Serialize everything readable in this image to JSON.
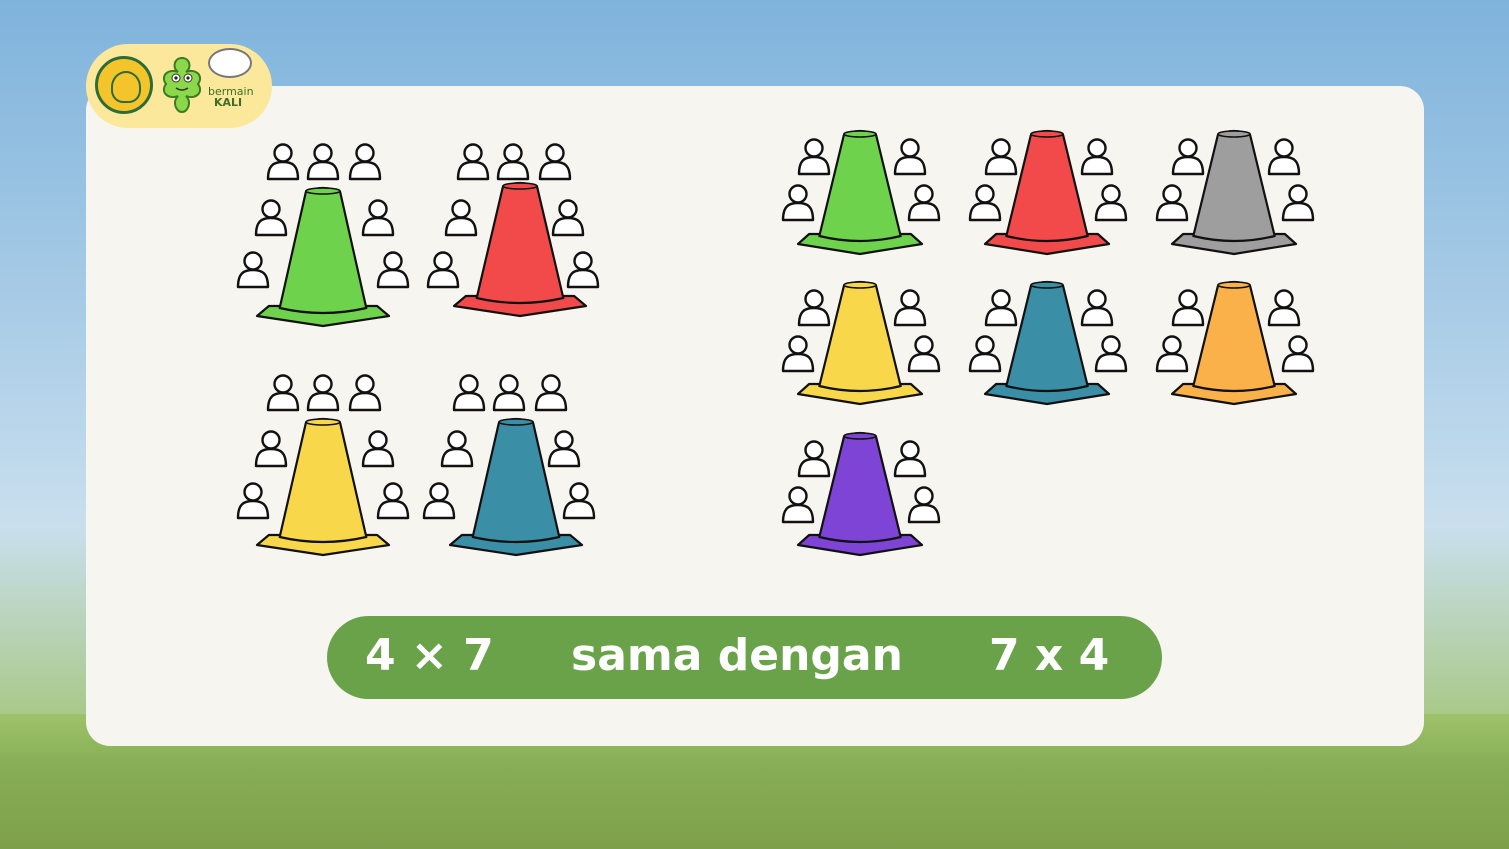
{
  "logo": {
    "wordmark_line1": "bermain",
    "wordmark_line2": "KALI"
  },
  "banner": {
    "left_expression": "4 × 7",
    "middle_text": "sama dengan",
    "right_expression": "7 x 4"
  },
  "groups_left": {
    "people_per_cone": 7,
    "cones": [
      {
        "color": "#6fd24c"
      },
      {
        "color": "#f24a4a"
      },
      {
        "color": "#f8d84a"
      },
      {
        "color": "#3a8fa6"
      }
    ]
  },
  "groups_right": {
    "people_per_cone": 4,
    "cones": [
      {
        "color": "#6fd24c"
      },
      {
        "color": "#f24a4a"
      },
      {
        "color": "#9e9e9e"
      },
      {
        "color": "#f8d84a"
      },
      {
        "color": "#3a8fa6"
      },
      {
        "color": "#fbb14a"
      },
      {
        "color": "#7d44d6"
      }
    ]
  },
  "colors": {
    "banner_green": "#6aa24a",
    "card_bg": "#f7f5f0",
    "badge_yellow": "#fbe89a"
  }
}
